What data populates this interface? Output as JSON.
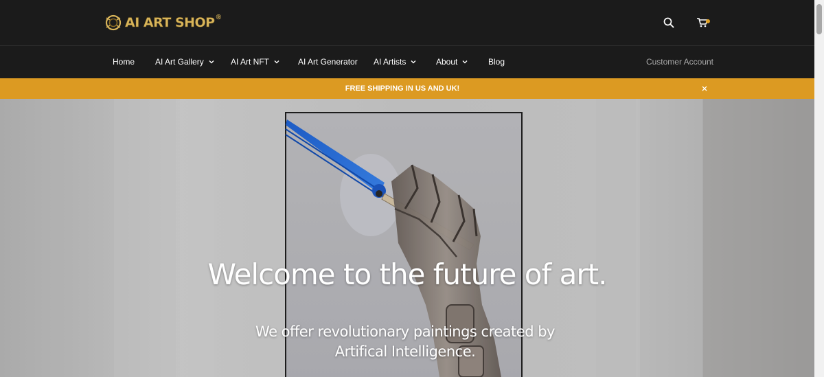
{
  "header": {
    "logo_text": "AI ART SHOP",
    "logo_mark": "®",
    "search_icon": "search-icon",
    "cart_icon": "cart-icon"
  },
  "nav": {
    "items": [
      {
        "label": "Home",
        "has_dropdown": false
      },
      {
        "label": "AI Art Gallery",
        "has_dropdown": true
      },
      {
        "label": "AI Art NFT",
        "has_dropdown": true
      },
      {
        "label": "AI Art Generator",
        "has_dropdown": false
      },
      {
        "label": "AI Artists",
        "has_dropdown": true
      },
      {
        "label": "About",
        "has_dropdown": true
      },
      {
        "label": "Blog",
        "has_dropdown": false
      }
    ],
    "account_label": "Customer Account"
  },
  "announcement": {
    "text": "FREE SHIPPING IN US AND UK!",
    "close_icon": "close-icon",
    "background": "#dc9a22"
  },
  "hero": {
    "title": "Welcome to the future of art.",
    "subtitle_line1": "We offer revolutionary paintings created by",
    "subtitle_line2": "Artifical Intelligence."
  },
  "colors": {
    "header_bg": "#1b1b1b",
    "accent": "#dc9a22",
    "logo_gold": "#d9b55a"
  }
}
